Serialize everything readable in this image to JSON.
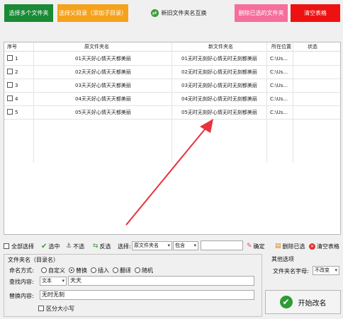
{
  "toolbar": {
    "select_files": "选择多个文件夹",
    "select_parent": "选择父目录（添加子目录）",
    "swap_names": "新旧文件夹名互换",
    "delete_selected": "删除已选的文件夹",
    "clear_table": "清空表格"
  },
  "table": {
    "headers": [
      "序号",
      "原文件夹名",
      "新文件夹名",
      "所在位置",
      "状态"
    ],
    "rows": [
      {
        "index": "1",
        "old": "01天天好心情天天都美丽",
        "new": "01无时无刻好心情无时无刻都美丽",
        "path": "C:\\Us...",
        "status": ""
      },
      {
        "index": "2",
        "old": "02天天好心情天天都美丽",
        "new": "02无时无刻好心情无时无刻都美丽",
        "path": "C:\\Us...",
        "status": ""
      },
      {
        "index": "3",
        "old": "03天天好心情天天都美丽",
        "new": "03无时无刻好心情无时无刻都美丽",
        "path": "C:\\Us...",
        "status": ""
      },
      {
        "index": "4",
        "old": "04天天好心情天天都美丽",
        "new": "04无时无刻好心情无时无刻都美丽",
        "path": "C:\\Us...",
        "status": ""
      },
      {
        "index": "5",
        "old": "05天天好心情天天都美丽",
        "new": "05无时无刻好心情无时无刻都美丽",
        "path": "C:\\Us...",
        "status": ""
      }
    ]
  },
  "filter_bar": {
    "select_all": "全部选择",
    "select": "选中",
    "unselect": "不选",
    "invert": "反选",
    "choose_label": "选择:",
    "column_value": "原文件夹名",
    "mode_value": "包含",
    "filter_text": "",
    "confirm": "确定",
    "delete_selected": "删除已选",
    "clear_table": "清空表格"
  },
  "rename_panel": {
    "title": "文件夹名（目录名）",
    "mode_label": "命名方式:",
    "modes": [
      "自定义",
      "替换",
      "插入",
      "翻译",
      "随机"
    ],
    "selected_mode": "替换",
    "find_label": "查找内容:",
    "find_type": "文本",
    "find_value": "天天",
    "replace_label": "替换内容:",
    "replace_value": "无时无刻",
    "case_sensitive": "区分大小写"
  },
  "other_options": {
    "title": "其他选项",
    "case_label": "文件夹名字母:",
    "case_value": "不改变"
  },
  "start_button": "开始改名",
  "colors": {
    "green_button": "#1a8a36",
    "orange_button": "#f5a21c",
    "pink_button": "#f56e9c",
    "red_button": "#ee1111",
    "arrow": "#e8323c"
  }
}
